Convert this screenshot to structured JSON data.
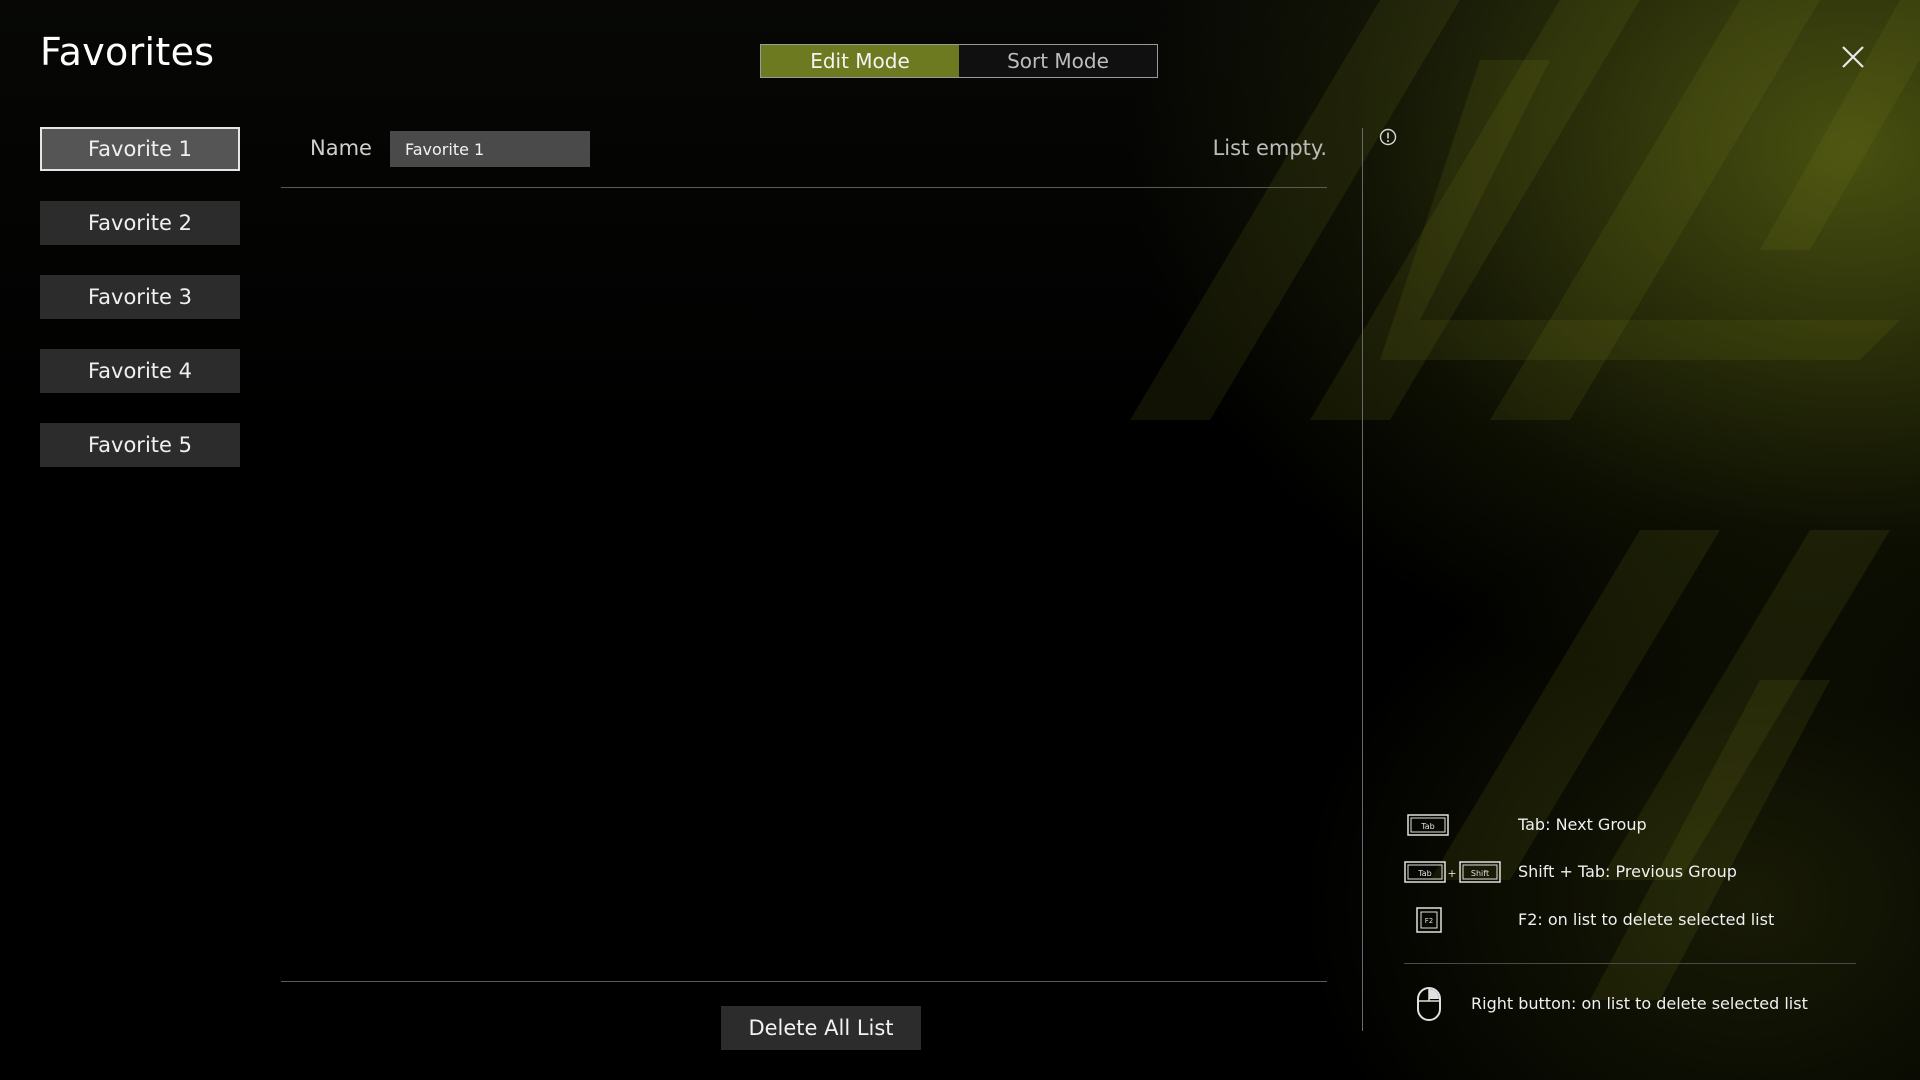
{
  "app": {
    "title": "Favorites"
  },
  "mode_toggle": {
    "edit_label": "Edit Mode",
    "sort_label": "Sort Mode",
    "active": "edit"
  },
  "sidebar": {
    "items": [
      {
        "label": "Favorite 1",
        "selected": true
      },
      {
        "label": "Favorite 2",
        "selected": false
      },
      {
        "label": "Favorite 3",
        "selected": false
      },
      {
        "label": "Favorite 4",
        "selected": false
      },
      {
        "label": "Favorite 5",
        "selected": false
      }
    ]
  },
  "editor": {
    "name_label": "Name",
    "name_value": "Favorite 1",
    "status": "List empty."
  },
  "footer": {
    "delete_all_label": "Delete All List"
  },
  "hints": {
    "tab": {
      "key": "Tab",
      "text": "Tab: Next Group"
    },
    "shift_tab": {
      "key_a": "Tab",
      "plus": "+",
      "key_b": "Shift",
      "text": "Shift + Tab: Previous Group"
    },
    "f2": {
      "key": "F2",
      "text": "F2: on list to delete selected list"
    },
    "mouse": {
      "text": "Right button: on list to delete selected list"
    }
  },
  "colors": {
    "accent": "#6e7a1f",
    "panel": "#2c2c2c",
    "selected_bg": "#555555"
  },
  "icons": {
    "close": "close-icon",
    "info": "info-icon",
    "mouse": "mouse-icon"
  }
}
